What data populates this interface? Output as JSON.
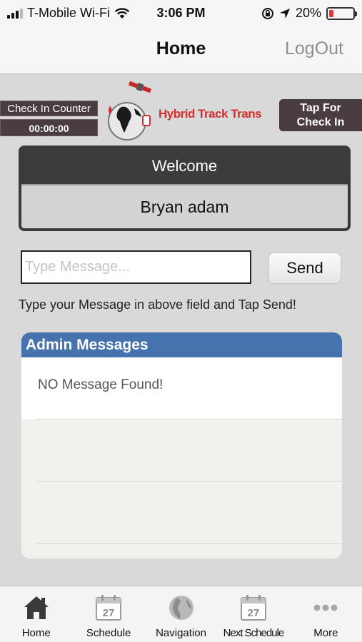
{
  "status_bar": {
    "carrier": "T-Mobile Wi-Fi",
    "time": "3:06 PM",
    "battery": "20%",
    "battery_level": 0.2
  },
  "nav": {
    "title": "Home",
    "logout_label": "LogOut"
  },
  "checkin_counter": {
    "label": "Check In Counter",
    "value": "00:00:00"
  },
  "logo": {
    "text": "Hybrid Track Trans"
  },
  "checkin_button": {
    "line1": "Tap For",
    "line2": "Check In"
  },
  "welcome": {
    "heading": "Welcome",
    "name": "Bryan adam"
  },
  "message": {
    "placeholder": "Type Message...",
    "value": "",
    "send_label": "Send",
    "hint": "Type your Message in above field and Tap Send!"
  },
  "admin_messages": {
    "heading": "Admin Messages",
    "empty_text": "NO Message Found!"
  },
  "tabs": [
    {
      "label": "Home",
      "icon": "home-icon"
    },
    {
      "label": "Schedule",
      "icon": "calendar-icon",
      "badge": "27"
    },
    {
      "label": "Navigation",
      "icon": "globe-icon"
    },
    {
      "label": "Next Schedule",
      "icon": "calendar-icon",
      "badge": "27"
    },
    {
      "label": "More",
      "icon": "more-icon"
    }
  ],
  "colors": {
    "dark_panel": "#4a3d3f",
    "admin_header": "#4672ad",
    "logo_red": "#d32f2f",
    "battery_red": "#e53935"
  }
}
